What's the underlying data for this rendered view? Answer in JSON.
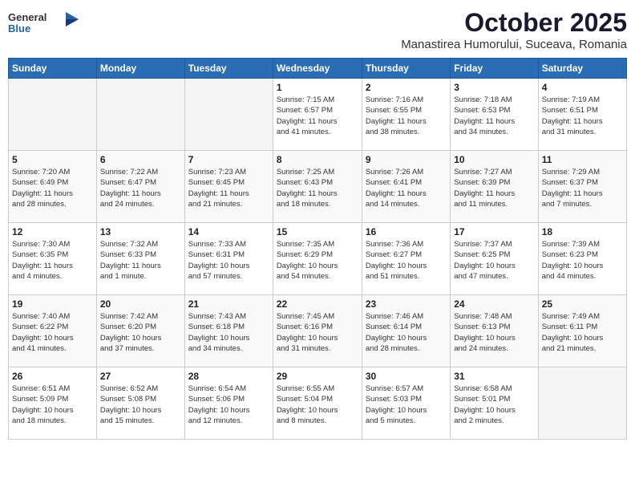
{
  "logo": {
    "general": "General",
    "blue": "Blue"
  },
  "header": {
    "month": "October 2025",
    "location": "Manastirea Humorului, Suceava, Romania"
  },
  "weekdays": [
    "Sunday",
    "Monday",
    "Tuesday",
    "Wednesday",
    "Thursday",
    "Friday",
    "Saturday"
  ],
  "weeks": [
    [
      {
        "day": "",
        "info": ""
      },
      {
        "day": "",
        "info": ""
      },
      {
        "day": "",
        "info": ""
      },
      {
        "day": "1",
        "info": "Sunrise: 7:15 AM\nSunset: 6:57 PM\nDaylight: 11 hours\nand 41 minutes."
      },
      {
        "day": "2",
        "info": "Sunrise: 7:16 AM\nSunset: 6:55 PM\nDaylight: 11 hours\nand 38 minutes."
      },
      {
        "day": "3",
        "info": "Sunrise: 7:18 AM\nSunset: 6:53 PM\nDaylight: 11 hours\nand 34 minutes."
      },
      {
        "day": "4",
        "info": "Sunrise: 7:19 AM\nSunset: 6:51 PM\nDaylight: 11 hours\nand 31 minutes."
      }
    ],
    [
      {
        "day": "5",
        "info": "Sunrise: 7:20 AM\nSunset: 6:49 PM\nDaylight: 11 hours\nand 28 minutes."
      },
      {
        "day": "6",
        "info": "Sunrise: 7:22 AM\nSunset: 6:47 PM\nDaylight: 11 hours\nand 24 minutes."
      },
      {
        "day": "7",
        "info": "Sunrise: 7:23 AM\nSunset: 6:45 PM\nDaylight: 11 hours\nand 21 minutes."
      },
      {
        "day": "8",
        "info": "Sunrise: 7:25 AM\nSunset: 6:43 PM\nDaylight: 11 hours\nand 18 minutes."
      },
      {
        "day": "9",
        "info": "Sunrise: 7:26 AM\nSunset: 6:41 PM\nDaylight: 11 hours\nand 14 minutes."
      },
      {
        "day": "10",
        "info": "Sunrise: 7:27 AM\nSunset: 6:39 PM\nDaylight: 11 hours\nand 11 minutes."
      },
      {
        "day": "11",
        "info": "Sunrise: 7:29 AM\nSunset: 6:37 PM\nDaylight: 11 hours\nand 7 minutes."
      }
    ],
    [
      {
        "day": "12",
        "info": "Sunrise: 7:30 AM\nSunset: 6:35 PM\nDaylight: 11 hours\nand 4 minutes."
      },
      {
        "day": "13",
        "info": "Sunrise: 7:32 AM\nSunset: 6:33 PM\nDaylight: 11 hours\nand 1 minute."
      },
      {
        "day": "14",
        "info": "Sunrise: 7:33 AM\nSunset: 6:31 PM\nDaylight: 10 hours\nand 57 minutes."
      },
      {
        "day": "15",
        "info": "Sunrise: 7:35 AM\nSunset: 6:29 PM\nDaylight: 10 hours\nand 54 minutes."
      },
      {
        "day": "16",
        "info": "Sunrise: 7:36 AM\nSunset: 6:27 PM\nDaylight: 10 hours\nand 51 minutes."
      },
      {
        "day": "17",
        "info": "Sunrise: 7:37 AM\nSunset: 6:25 PM\nDaylight: 10 hours\nand 47 minutes."
      },
      {
        "day": "18",
        "info": "Sunrise: 7:39 AM\nSunset: 6:23 PM\nDaylight: 10 hours\nand 44 minutes."
      }
    ],
    [
      {
        "day": "19",
        "info": "Sunrise: 7:40 AM\nSunset: 6:22 PM\nDaylight: 10 hours\nand 41 minutes."
      },
      {
        "day": "20",
        "info": "Sunrise: 7:42 AM\nSunset: 6:20 PM\nDaylight: 10 hours\nand 37 minutes."
      },
      {
        "day": "21",
        "info": "Sunrise: 7:43 AM\nSunset: 6:18 PM\nDaylight: 10 hours\nand 34 minutes."
      },
      {
        "day": "22",
        "info": "Sunrise: 7:45 AM\nSunset: 6:16 PM\nDaylight: 10 hours\nand 31 minutes."
      },
      {
        "day": "23",
        "info": "Sunrise: 7:46 AM\nSunset: 6:14 PM\nDaylight: 10 hours\nand 28 minutes."
      },
      {
        "day": "24",
        "info": "Sunrise: 7:48 AM\nSunset: 6:13 PM\nDaylight: 10 hours\nand 24 minutes."
      },
      {
        "day": "25",
        "info": "Sunrise: 7:49 AM\nSunset: 6:11 PM\nDaylight: 10 hours\nand 21 minutes."
      }
    ],
    [
      {
        "day": "26",
        "info": "Sunrise: 6:51 AM\nSunset: 5:09 PM\nDaylight: 10 hours\nand 18 minutes."
      },
      {
        "day": "27",
        "info": "Sunrise: 6:52 AM\nSunset: 5:08 PM\nDaylight: 10 hours\nand 15 minutes."
      },
      {
        "day": "28",
        "info": "Sunrise: 6:54 AM\nSunset: 5:06 PM\nDaylight: 10 hours\nand 12 minutes."
      },
      {
        "day": "29",
        "info": "Sunrise: 6:55 AM\nSunset: 5:04 PM\nDaylight: 10 hours\nand 8 minutes."
      },
      {
        "day": "30",
        "info": "Sunrise: 6:57 AM\nSunset: 5:03 PM\nDaylight: 10 hours\nand 5 minutes."
      },
      {
        "day": "31",
        "info": "Sunrise: 6:58 AM\nSunset: 5:01 PM\nDaylight: 10 hours\nand 2 minutes."
      },
      {
        "day": "",
        "info": ""
      }
    ]
  ]
}
